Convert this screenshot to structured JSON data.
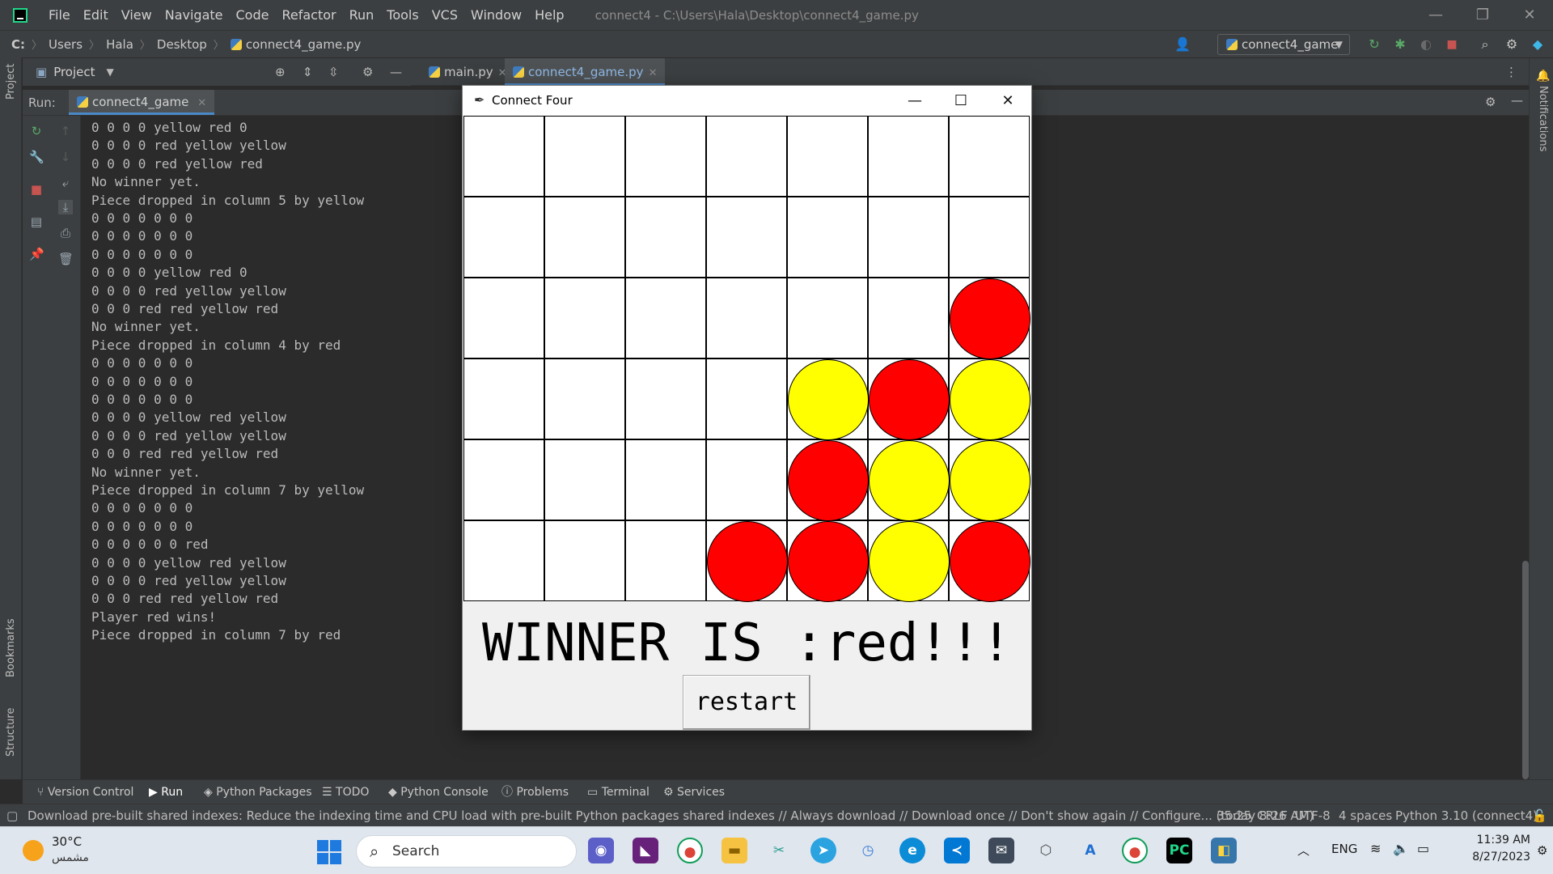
{
  "window": {
    "menu": [
      "File",
      "Edit",
      "View",
      "Navigate",
      "Code",
      "Refactor",
      "Run",
      "Tools",
      "VCS",
      "Window",
      "Help"
    ],
    "title": "connect4 - C:\\Users\\Hala\\Desktop\\connect4_game.py",
    "controls": {
      "minimize": "—",
      "restore": "❐",
      "close": "✕"
    }
  },
  "breadcrumb": [
    "C:",
    "Users",
    "Hala",
    "Desktop",
    "connect4_game.py"
  ],
  "toolbar": {
    "run_config": "connect4_game"
  },
  "left_strip": {
    "top": "Project",
    "bookmarks": "Bookmarks",
    "structure": "Structure"
  },
  "project_header": {
    "label": "Project"
  },
  "editor_tabs": [
    {
      "label": "main.py"
    },
    {
      "label": "connect4_game.py"
    }
  ],
  "run_panel": {
    "label": "Run:",
    "tab": "connect4_game"
  },
  "right_strip": {
    "notifications": "Notifications"
  },
  "console_lines": [
    "0 0 0 0 yellow red 0",
    "0 0 0 0 red yellow yellow",
    "0 0 0 0 red yellow red",
    "No winner yet.",
    "Piece dropped in column 5 by yellow",
    "0 0 0 0 0 0 0",
    "0 0 0 0 0 0 0",
    "0 0 0 0 0 0 0",
    "0 0 0 0 yellow red 0",
    "0 0 0 0 red yellow yellow",
    "0 0 0 red red yellow red",
    "No winner yet.",
    "Piece dropped in column 4 by red",
    "0 0 0 0 0 0 0",
    "0 0 0 0 0 0 0",
    "0 0 0 0 0 0 0",
    "0 0 0 0 yellow red yellow",
    "0 0 0 0 red yellow yellow",
    "0 0 0 red red yellow red",
    "No winner yet.",
    "Piece dropped in column 7 by yellow",
    "0 0 0 0 0 0 0",
    "0 0 0 0 0 0 0",
    "0 0 0 0 0 0 red",
    "0 0 0 0 yellow red yellow",
    "0 0 0 0 red yellow yellow",
    "0 0 0 red red yellow red",
    "Player red wins!",
    "Piece dropped in column 7 by red"
  ],
  "bottom_tools": [
    "Version Control",
    "Run",
    "Python Packages",
    "TODO",
    "Python Console",
    "Problems",
    "Terminal",
    "Services"
  ],
  "status": {
    "message": "Download pre-built shared indexes: Reduce the indexing time and CPU load with pre-built Python packages shared indexes // Always download // Download once // Don't show again // Configure... (today 8:26 AM)",
    "position": "35:25",
    "line_sep": "CRLF",
    "encoding": "UTF-8",
    "indent": "4 spaces",
    "interpreter": "Python 3.10 (connect4)"
  },
  "game": {
    "title": "Connect Four",
    "winner_text": "WINNER IS :red!!!",
    "restart_label": "restart",
    "rows": 6,
    "cols": 7,
    "colors": {
      "red": "#ff0000",
      "yellow": "#ffff00",
      "empty": "#ffffff"
    },
    "board": [
      [
        0,
        0,
        0,
        0,
        0,
        0,
        0
      ],
      [
        0,
        0,
        0,
        0,
        0,
        0,
        0
      ],
      [
        0,
        0,
        0,
        0,
        0,
        0,
        "red"
      ],
      [
        0,
        0,
        0,
        0,
        "yellow",
        "red",
        "yellow"
      ],
      [
        0,
        0,
        0,
        0,
        "red",
        "yellow",
        "yellow"
      ],
      [
        0,
        0,
        0,
        "red",
        "red",
        "yellow",
        "red"
      ]
    ]
  },
  "taskbar": {
    "weather_temp": "30°C",
    "weather_desc": "مشمس",
    "search_label": "Search",
    "language": "ENG",
    "time": "11:39 AM",
    "date": "8/27/2023"
  }
}
